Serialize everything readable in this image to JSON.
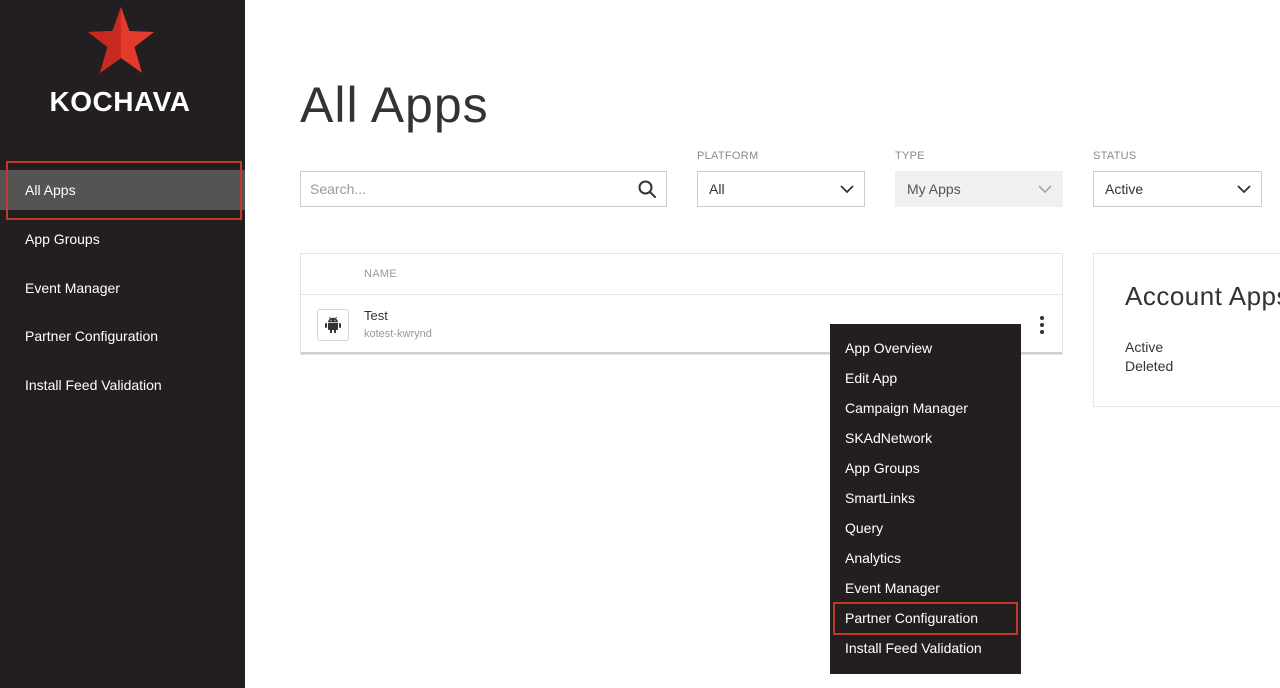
{
  "sidebar": {
    "logo_text": "KOCHAVA",
    "items": [
      {
        "label": "All Apps"
      },
      {
        "label": "App Groups"
      },
      {
        "label": "Event Manager"
      },
      {
        "label": "Partner Configuration"
      },
      {
        "label": "Install Feed Validation"
      }
    ]
  },
  "main": {
    "title": "All Apps",
    "search": {
      "placeholder": "Search...",
      "value": ""
    },
    "filters": [
      {
        "label": "PLATFORM",
        "value": "All"
      },
      {
        "label": "TYPE",
        "value": "My Apps"
      },
      {
        "label": "STATUS",
        "value": "Active"
      }
    ],
    "table": {
      "columns": [
        "NAME"
      ],
      "rows": [
        {
          "name": "Test",
          "id": "kotest-kwrynd",
          "platform_icon": "android-icon"
        }
      ]
    },
    "account_card": {
      "title": "Account Apps",
      "stats": [
        "Active",
        "Deleted"
      ]
    }
  },
  "menu": {
    "items": [
      {
        "label": "App Overview"
      },
      {
        "label": "Edit App"
      },
      {
        "label": "Campaign Manager"
      },
      {
        "label": "SKAdNetwork"
      },
      {
        "label": "App Groups"
      },
      {
        "label": "SmartLinks"
      },
      {
        "label": "Query"
      },
      {
        "label": "Analytics"
      },
      {
        "label": "Event Manager"
      },
      {
        "label": "Partner Configuration"
      },
      {
        "label": "Install Feed Validation"
      }
    ]
  },
  "colors": {
    "sidebar_bg": "#231f20",
    "active_nav_bg": "#555354",
    "highlight_border": "#c0392b",
    "logo_star": "#e23b2b"
  }
}
